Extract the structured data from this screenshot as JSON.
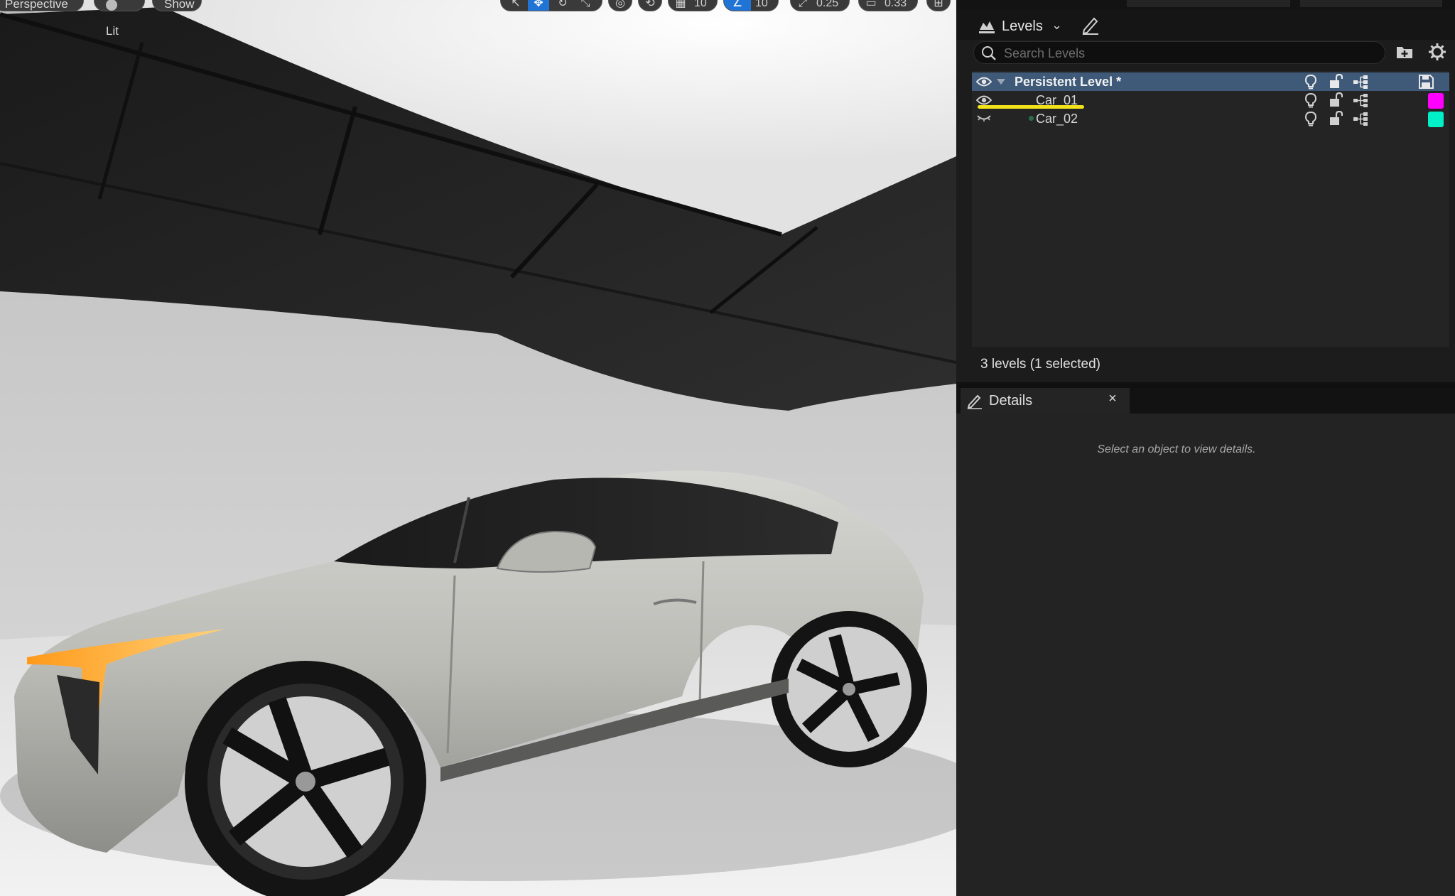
{
  "viewport": {
    "view_mode_label": "Perspective",
    "lit_label": "Lit",
    "show_label": "Show",
    "grid_snap_value": "10",
    "rotation_snap_value": "10",
    "scale_snap_value": "0.25",
    "camera_speed_value": "0.33"
  },
  "levels_panel": {
    "tab_label": "Levels",
    "search_placeholder": "Search Levels",
    "items": [
      {
        "name": "Persistent Level *",
        "selected": true
      },
      {
        "name": "Car_01",
        "color": "#ff00ff"
      },
      {
        "name": "Car_02",
        "color": "#00f0c8"
      }
    ],
    "status_text": "3 levels (1 selected)"
  },
  "details_panel": {
    "tab_label": "Details",
    "close_label": "×",
    "empty_text": "Select an object to view details."
  },
  "colors": {
    "selection_row": "#3f5a78",
    "accent_blue": "#1f74d6",
    "annotation_yellow": "#f2e21a"
  }
}
